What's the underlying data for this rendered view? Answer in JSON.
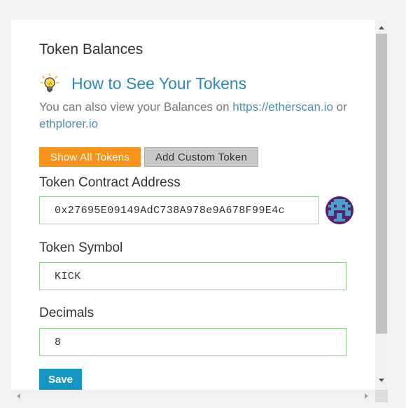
{
  "panel": {
    "title": "Token Balances"
  },
  "help": {
    "icon": "lightbulb-icon",
    "link_label": "How to See Your Tokens",
    "text_prefix": "You can also view your Balances on ",
    "link1": "https://etherscan.io",
    "text_middle": " or ",
    "link2": "ethplorer.io"
  },
  "tabs": {
    "show_all": "Show All Tokens",
    "add_custom": "Add Custom Token"
  },
  "form": {
    "contract_label": "Token Contract Address",
    "contract_value": "0x27695E09149AdC738A978e9A678F99E4c",
    "symbol_label": "Token Symbol",
    "symbol_value": "KICK",
    "decimals_label": "Decimals",
    "decimals_value": "8",
    "save_label": "Save"
  },
  "colors": {
    "accent_orange": "#f7931a",
    "link_blue": "#2a88b5",
    "save_blue": "#1596c0",
    "input_border": "#8fd38f"
  }
}
